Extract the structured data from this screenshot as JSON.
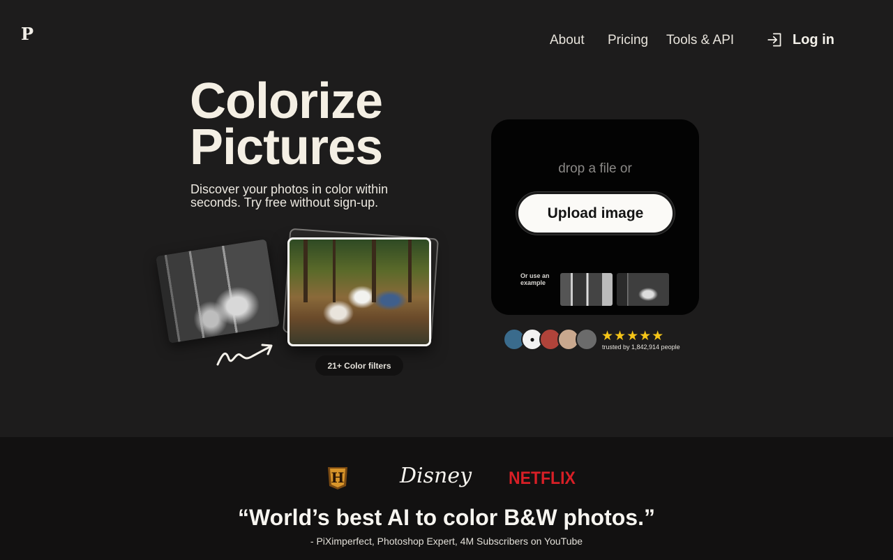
{
  "header": {
    "logo": "P",
    "nav": [
      {
        "label": "About"
      },
      {
        "label": "Pricing"
      },
      {
        "label": "Tools & API"
      }
    ],
    "login_label": "Log in",
    "login_icon": "login-arrow-icon"
  },
  "hero": {
    "title_line1": "Colorize",
    "title_line2": "Pictures",
    "subtitle": "Discover your photos in color within seconds. Try free without sign-up.",
    "filters_pill": "21+ Color filters"
  },
  "upload": {
    "drop_text": "drop a file or",
    "button_label": "Upload image",
    "example_label": "Or use an example"
  },
  "social_proof": {
    "stars": "★★★★★",
    "rating": 5,
    "trusted_text": "trusted by 1,842,914 people"
  },
  "brands": {
    "history": "H",
    "disney": "Disney",
    "netflix": "NETFLIX"
  },
  "testimonial": {
    "quote": "“World’s best AI to color B&W photos.”",
    "attribution": "- PiXimperfect, Photoshop Expert, 4M Subscribers on YouTube"
  },
  "colors": {
    "background": "#1d1c1c",
    "band": "#121111",
    "netflix_red": "#d81f26",
    "star_yellow": "#f5c518"
  }
}
